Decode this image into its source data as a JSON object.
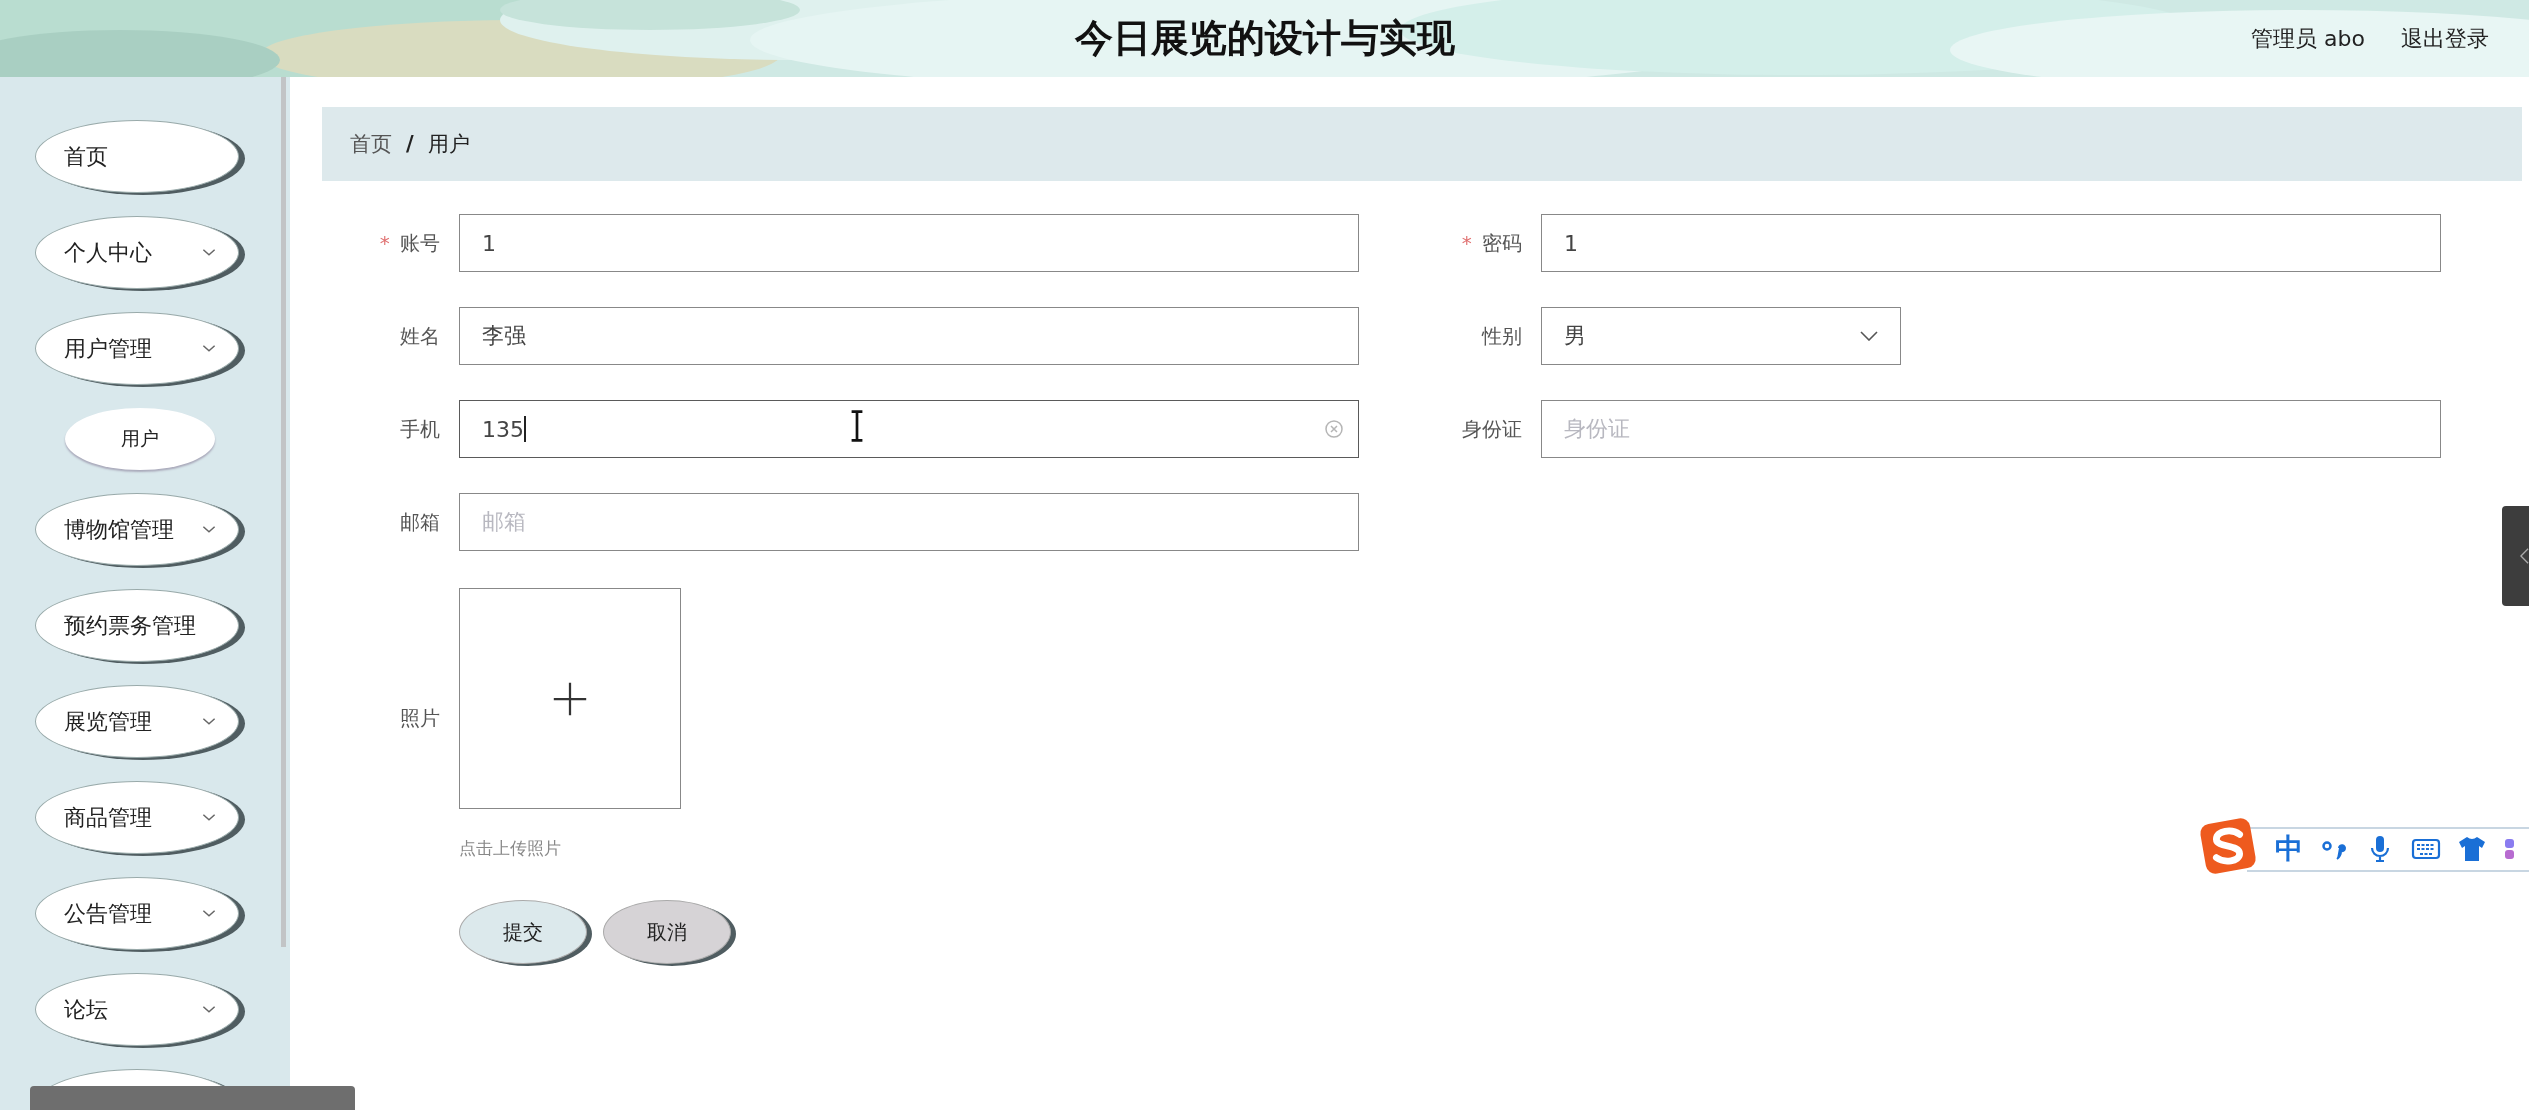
{
  "header": {
    "title": "今日展览的设计与实现",
    "user": "管理员 abo",
    "logout": "退出登录"
  },
  "sidebar": {
    "items": [
      {
        "label": "首页",
        "expandable": false
      },
      {
        "label": "个人中心",
        "expandable": true
      },
      {
        "label": "用户管理",
        "expandable": true,
        "children": [
          {
            "label": "用户"
          }
        ]
      },
      {
        "label": "博物馆管理",
        "expandable": true
      },
      {
        "label": "预约票务管理",
        "expandable": false
      },
      {
        "label": "展览管理",
        "expandable": true
      },
      {
        "label": "商品管理",
        "expandable": true
      },
      {
        "label": "公告管理",
        "expandable": true
      },
      {
        "label": "论坛",
        "expandable": true
      }
    ]
  },
  "breadcrumb": {
    "items": [
      "首页",
      "用户"
    ],
    "separator": "/"
  },
  "form": {
    "fields": [
      {
        "kind": "input",
        "label": "账号",
        "required": true,
        "value": "1",
        "focused": false
      },
      {
        "kind": "input",
        "label": "密码",
        "required": true,
        "value": "1",
        "focused": false
      },
      {
        "kind": "input",
        "label": "姓名",
        "required": false,
        "value": "李强",
        "focused": false
      },
      {
        "kind": "select",
        "label": "性别",
        "required": false,
        "value": "男"
      },
      {
        "kind": "input",
        "label": "手机",
        "required": false,
        "value": "135",
        "focused": true
      },
      {
        "kind": "input",
        "label": "身份证",
        "required": false,
        "placeholder": "身份证",
        "focused": false
      },
      {
        "kind": "input",
        "label": "邮箱",
        "required": false,
        "placeholder": "邮箱",
        "focused": false
      },
      {
        "kind": "upload",
        "label": "照片",
        "required": false,
        "hint": "点击上传照片"
      }
    ],
    "required_mark": "*",
    "buttons": [
      {
        "label": "提交",
        "kind": "primary"
      },
      {
        "label": "取消",
        "kind": "secondary"
      }
    ]
  },
  "ime_toolbar": {
    "mode": "中"
  }
}
